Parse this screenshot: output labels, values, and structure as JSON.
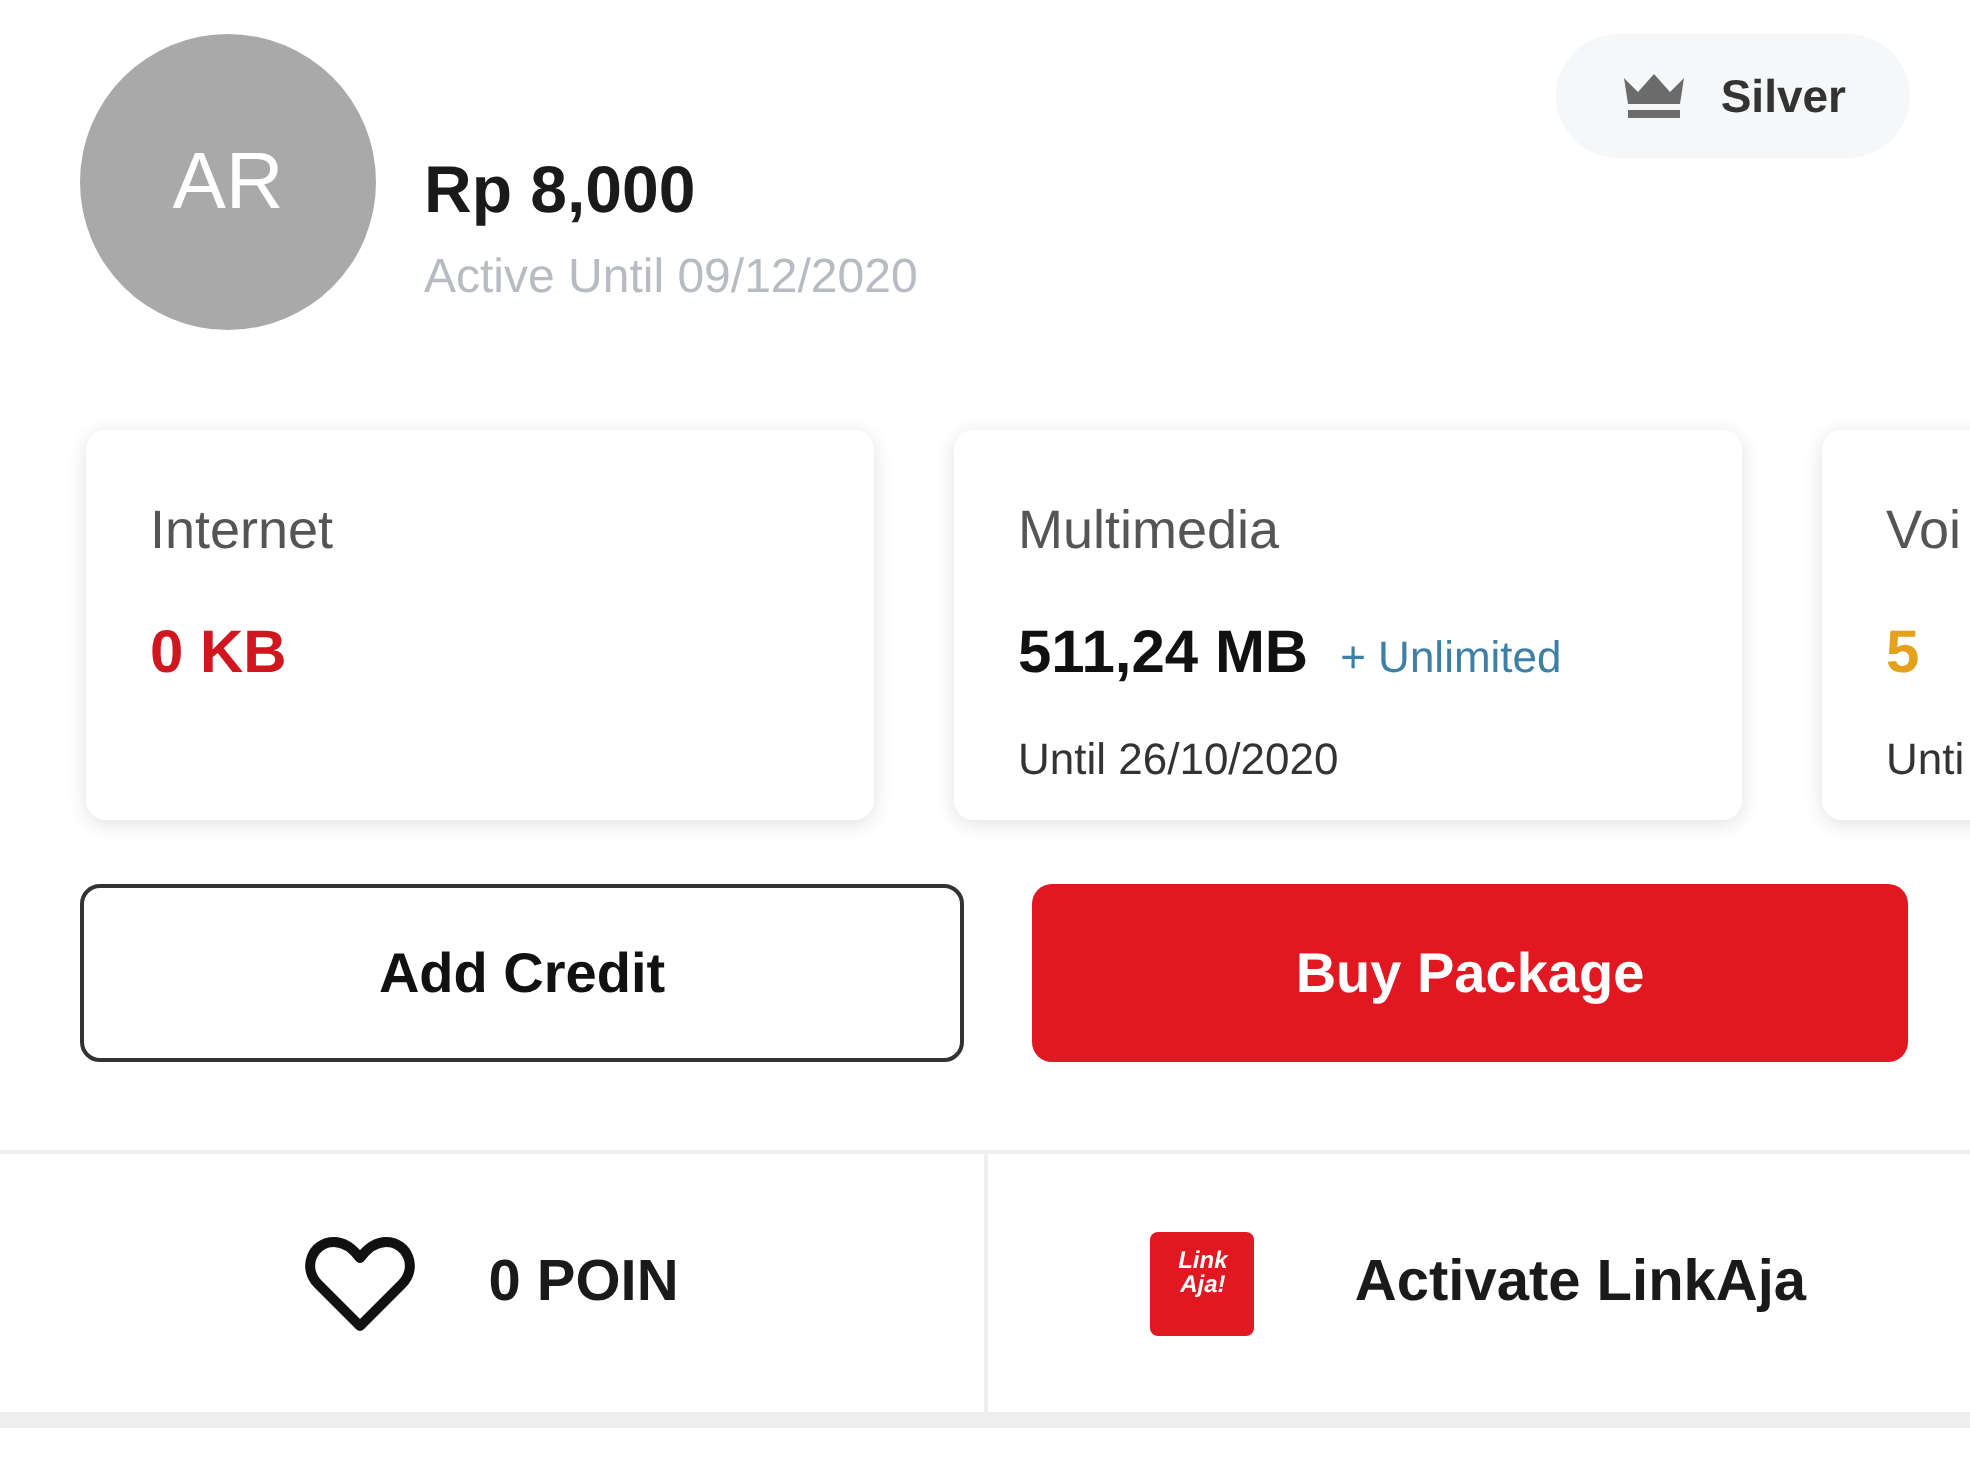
{
  "profile": {
    "initials": "AR",
    "balance": "Rp 8,000",
    "active_until": "Active Until 09/12/2020",
    "tier": "Silver"
  },
  "quotas": [
    {
      "label": "Internet",
      "value": "0 KB",
      "color": "#d0161f"
    },
    {
      "label": "Multimedia",
      "value": "511,24 MB",
      "color": "#111111",
      "extra": "+ Unlimited",
      "until": "Until 26/10/2020"
    },
    {
      "label": "Voi",
      "value": "5",
      "color": "#e5a11b",
      "until": "Unti"
    }
  ],
  "buttons": [
    {
      "label": "Add Credit",
      "kind": "outline"
    },
    {
      "label": "Buy Package",
      "kind": "primary"
    }
  ],
  "footer": {
    "points": "0 POIN",
    "logo_text": "Link Aja!",
    "link": "Activate LinkAja"
  }
}
